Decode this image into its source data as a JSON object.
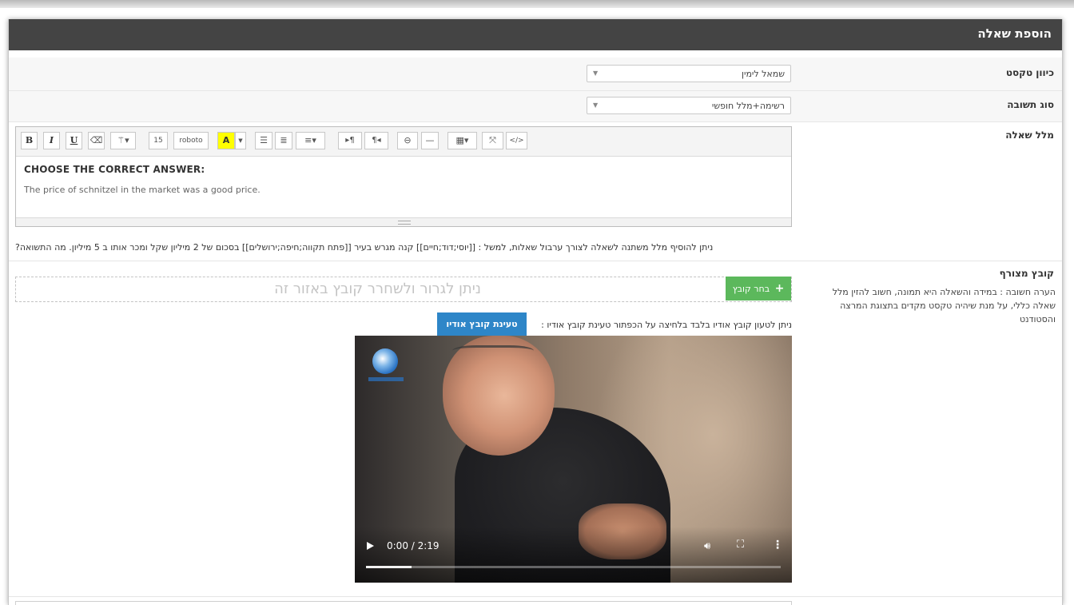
{
  "panel": {
    "title": "הוספת שאלה"
  },
  "fields": {
    "direction": {
      "label": "כיוון טקסט",
      "value": "שמאל לימין"
    },
    "answer_type": {
      "label": "סוג תשובה",
      "value": "רשימה+מלל חופשי"
    },
    "question_text": {
      "label": "מלל שאלה",
      "heading": "CHOOSE THE CORRECT ANSWER:",
      "body": "The price of schnitzel in the market was a good price."
    }
  },
  "toolbar": {
    "bold": "B",
    "italic": "I",
    "underline": "U",
    "font_size": "15",
    "font_name": "roboto",
    "highlight": "A"
  },
  "hint": "ניתן להוסיף מלל משתנה לשאלה לצורך ערבול שאלות, למשל : [[יוסי;דוד;חיים]] קנה מגרש בעיר [[פתח תקווה;חיפה;ירושלים]] בסכום של 2 מיליון שקל ומכר אותו ב 5 מיליון. מה התשואה?",
  "attachment": {
    "label": "קובץ מצורף",
    "note": "הערה חשובה : במידה והשאלה היא תמונה, חשוב להזין מלל שאלה כללי, על מנת שיהיה טקסט מקדים בתצוגת המרצה והסטודנט",
    "dropzone": "ניתן לגרור ולשחרר קובץ באזור זה",
    "choose_button": "בחר קובץ",
    "audio_instruction": "ניתן לטעון קובץ אודיו בלבד בלחיצה על הכפתור טעינת קובץ אודיו :",
    "audio_button": "טעינת קובץ אודיו"
  },
  "video": {
    "time": "0:00 / 2:19",
    "progress_fraction": 0.11
  }
}
